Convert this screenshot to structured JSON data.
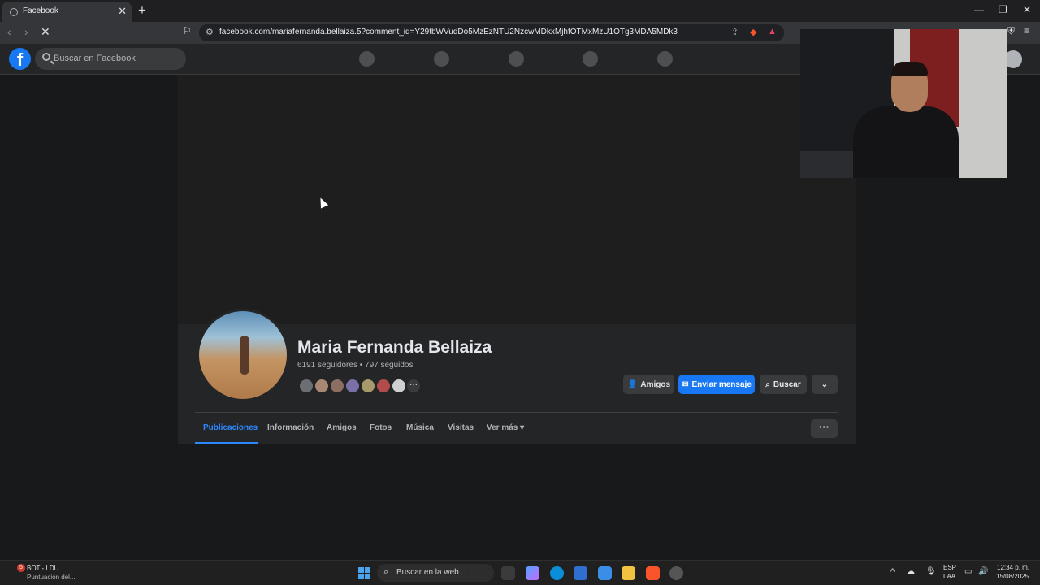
{
  "browser": {
    "tab_title": "Facebook",
    "url": "facebook.com/mariafernanda.bellaiza.5?comment_id=Y29tbWVudDo5MzEzNTU2NzcwMDkxMjhfOTMxMzU1OTg3MDA5MDk3"
  },
  "facebook": {
    "search_placeholder": "Buscar en Facebook"
  },
  "profile": {
    "name": "Maria Fernanda Bellaiza",
    "followers_line": "6191 seguidores • 797 seguidos",
    "buttons": {
      "friends": "Amigos",
      "message": "Enviar mensaje",
      "search": "Buscar"
    },
    "tabs": [
      "Publicaciones",
      "Información",
      "Amigos",
      "Fotos",
      "Música",
      "Visitas",
      "Ver más"
    ],
    "active_tab": "Publicaciones"
  },
  "taskbar": {
    "weather_badge": "5",
    "weather_title": "BOT - LDU",
    "weather_sub": "Puntuación del...",
    "search_placeholder": "Buscar en la web...",
    "lang_1": "ESP",
    "lang_2": "LAA",
    "time": "12:34 p. m.",
    "date": "15/08/2025"
  },
  "colors": {
    "accent": "#1877f2",
    "active_tab": "#2d88ff",
    "bg": "#18191a"
  }
}
